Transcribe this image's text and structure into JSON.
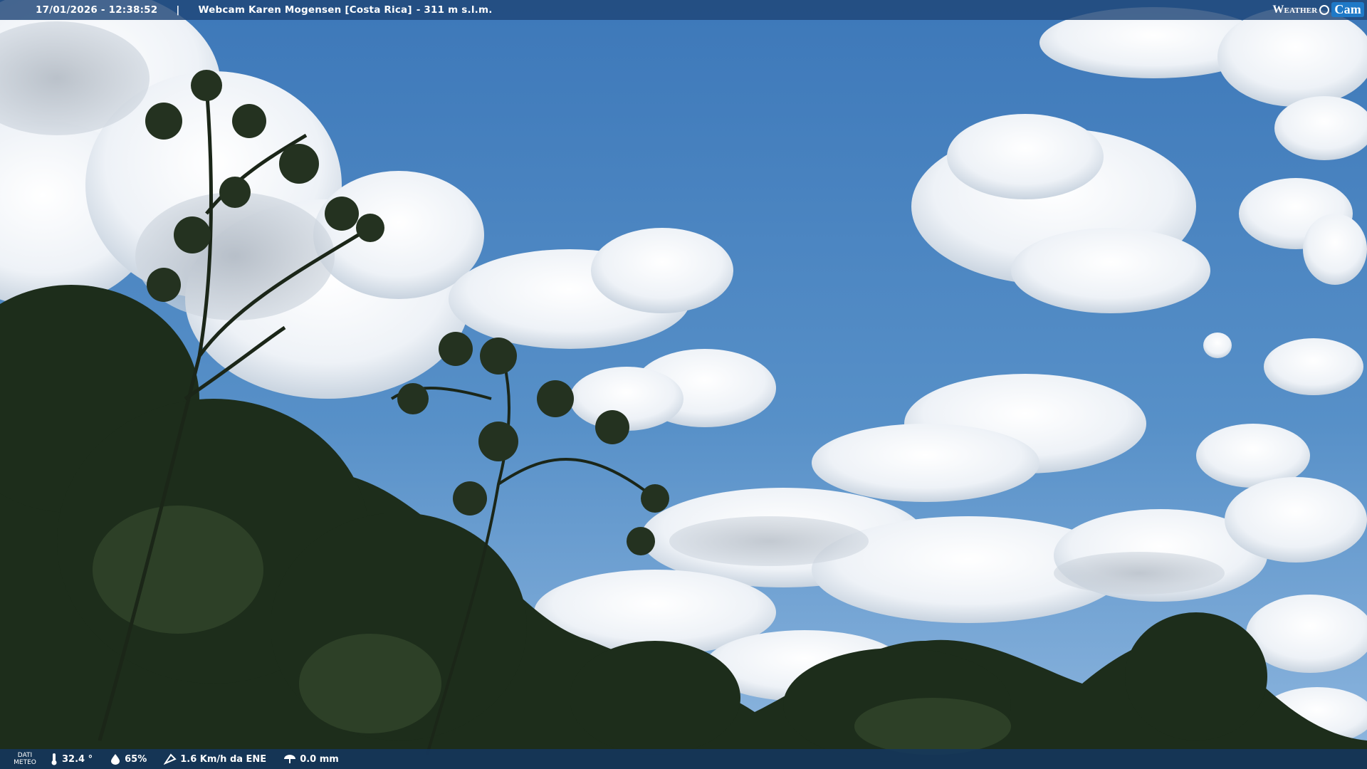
{
  "topbar": {
    "datetime": "17/01/2026 - 12:38:52",
    "separator": "|",
    "title": "Webcam Karen Mogensen [Costa Rica]",
    "altitude": "- 311 m s.l.m."
  },
  "logo": {
    "weather": "Weather",
    "cam": "Cam"
  },
  "weather": {
    "label_top": "DATI",
    "label_bottom": "METEO",
    "temperature": "32.4 °",
    "humidity": "65%",
    "wind": "1.6 Km/h da ENE",
    "rain": "0.0 mm"
  },
  "colors": {
    "sky": "#4f88c4",
    "bar": "#1f4c80",
    "foliage": "#1f2f1d"
  },
  "icons": [
    "thermometer-icon",
    "humidity-icon",
    "wind-icon",
    "rain-icon",
    "camera-lens-icon"
  ]
}
